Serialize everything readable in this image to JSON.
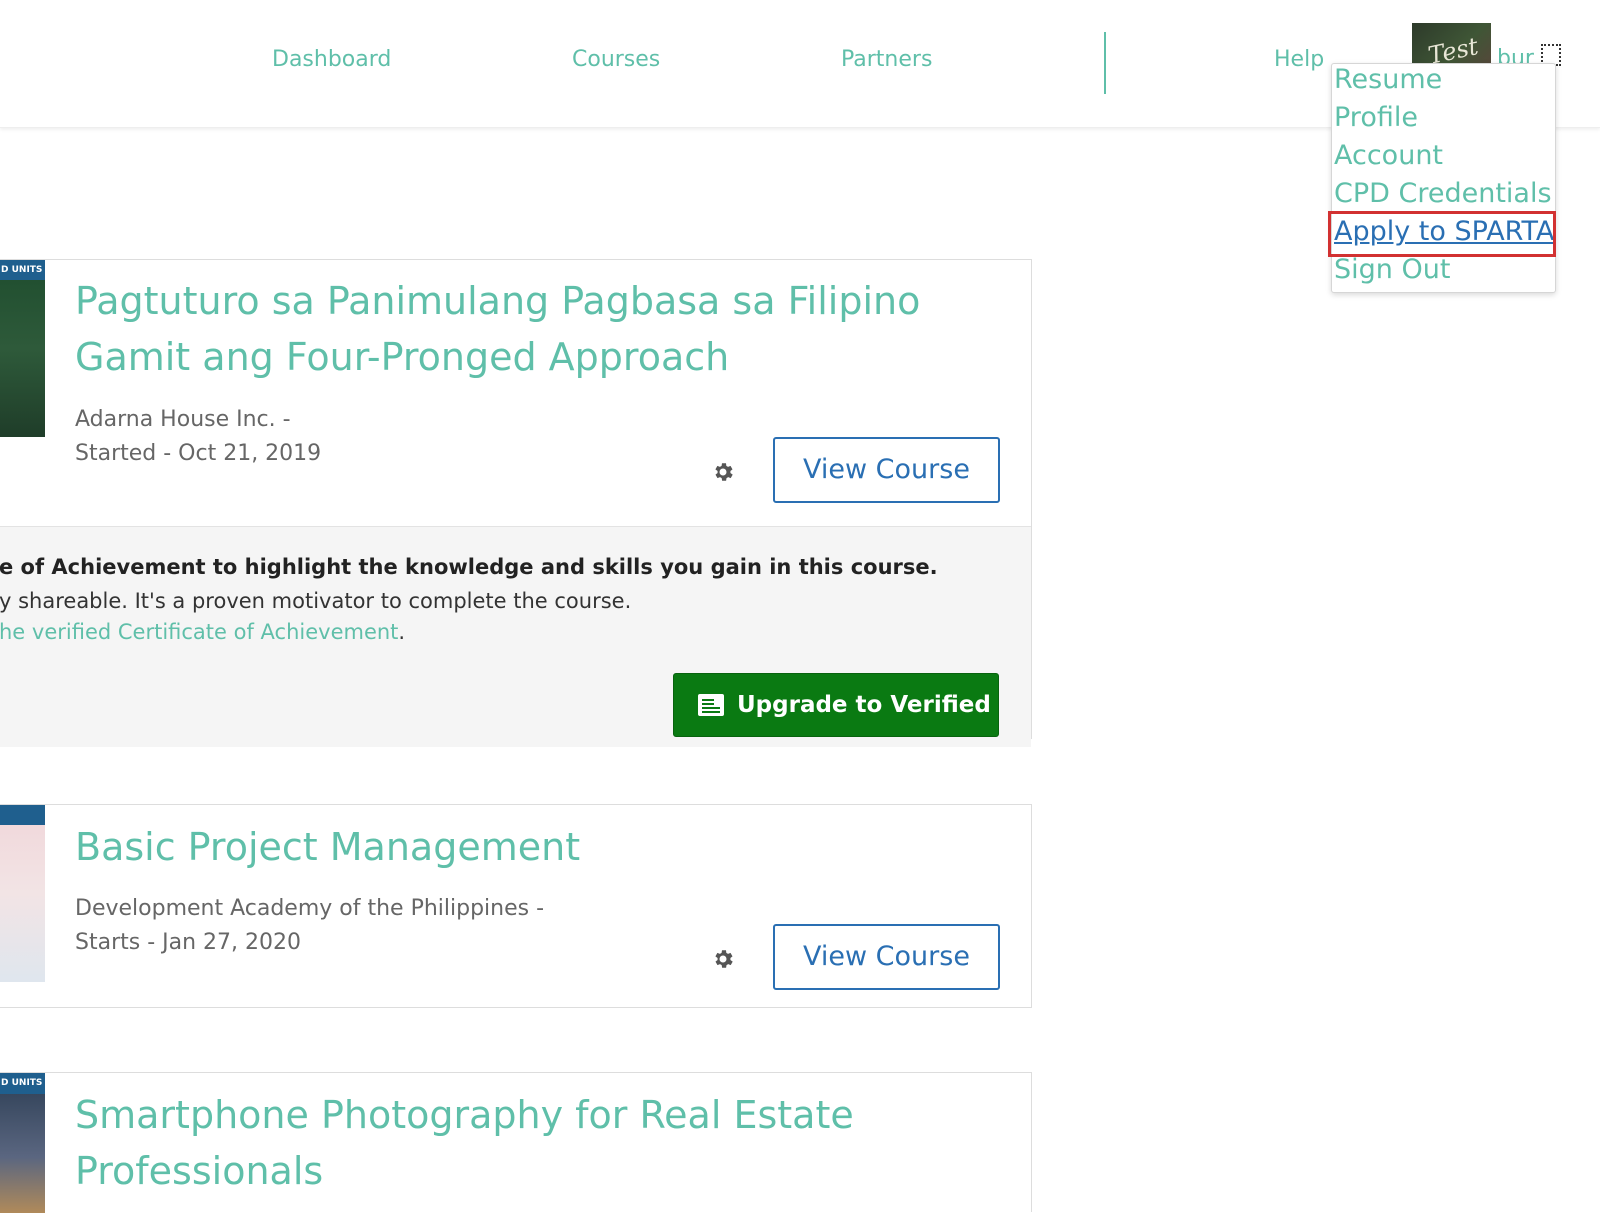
{
  "nav": {
    "dashboard": "Dashboard",
    "courses": "Courses",
    "partners": "Partners",
    "help": "Help",
    "username": "bur",
    "avatar_text": "Test"
  },
  "dropdown": {
    "items": [
      "Resume",
      "Profile",
      "Account",
      "CPD Credentials",
      "Apply to SPARTA",
      "Sign Out"
    ],
    "highlighted": "Apply to SPARTA"
  },
  "courses": [
    {
      "badge": "D UNITS",
      "title": "Pagtuturo sa Panimulang Pagbasa sa Filipino Gamit ang Four-Pronged Approach",
      "org": "Adarna House Inc. -",
      "date": "Started - Oct 21, 2019",
      "button": "View Course"
    },
    {
      "badge": "",
      "title": "Basic Project Management",
      "org": "Development Academy of the Philippines -",
      "date": "Starts - Jan 27, 2020",
      "button": "View Course"
    },
    {
      "badge": "D UNITS",
      "title": "Smartphone Photography for Real Estate Professionals",
      "org": "",
      "date": "",
      "button": ""
    }
  ],
  "upsell": {
    "line1": "e of Achievement to highlight the knowledge and skills you gain in this course.",
    "line2": "y shareable. It's a proven motivator to complete the course.",
    "line3_link": "he verified Certificate of Achievement",
    "line3_suffix": ".",
    "button": "Upgrade to Verified"
  },
  "colors": {
    "accent": "#5fbfa9",
    "link_blue": "#2a6fb3",
    "upgrade_green": "#0a7a12",
    "highlight_red": "#d23131"
  }
}
